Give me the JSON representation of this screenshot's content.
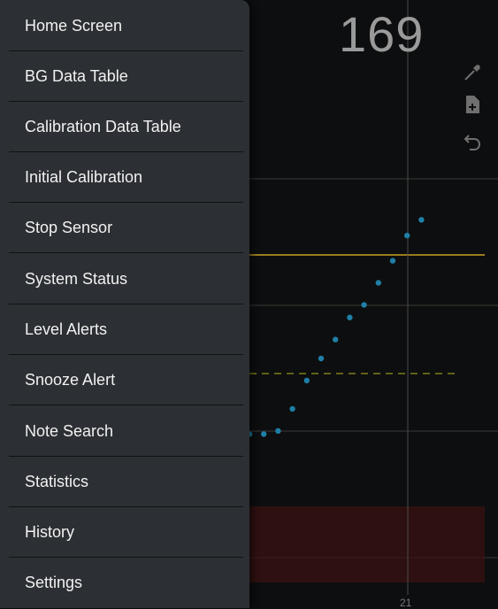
{
  "drawer": {
    "items": [
      {
        "label": "Home Screen"
      },
      {
        "label": "BG Data Table"
      },
      {
        "label": "Calibration Data Table"
      },
      {
        "label": "Initial Calibration"
      },
      {
        "label": "Stop Sensor"
      },
      {
        "label": "System Status"
      },
      {
        "label": "Level Alerts"
      },
      {
        "label": "Snooze Alert"
      },
      {
        "label": "Note Search"
      },
      {
        "label": "Statistics"
      },
      {
        "label": "History"
      },
      {
        "label": "Settings"
      }
    ]
  },
  "status": {
    "bg_value": "169",
    "trend_icon": "arrow-up-right-icon"
  },
  "toolbar": {
    "icons": [
      "eyedropper-icon",
      "note-add-icon",
      "undo-icon"
    ]
  },
  "chart_data": {
    "type": "scatter",
    "x_tick_labels": [
      "21"
    ],
    "high_line_color": "#c9a227",
    "target_line_color": "#8c8a1a",
    "low_zone_color": "#3a1212",
    "point_color": "#1f7fa6",
    "points_relative": [
      [
        0,
        0.1
      ],
      [
        1,
        0.1
      ],
      [
        2,
        0.11
      ],
      [
        3,
        0.18
      ],
      [
        4,
        0.27
      ],
      [
        5,
        0.34
      ],
      [
        6,
        0.4
      ],
      [
        7,
        0.47
      ],
      [
        8,
        0.51
      ],
      [
        9,
        0.58
      ],
      [
        10,
        0.65
      ],
      [
        11,
        0.73
      ],
      [
        12,
        0.78
      ]
    ],
    "y_range_relative": [
      0,
      1
    ]
  }
}
